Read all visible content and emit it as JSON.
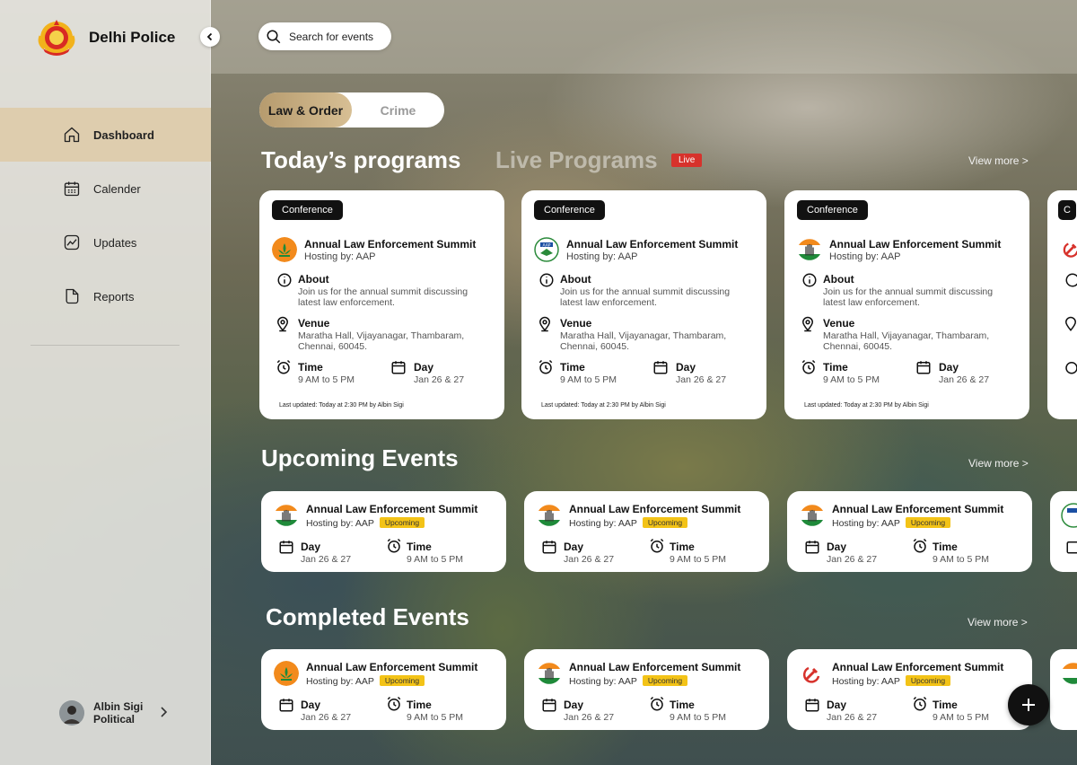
{
  "sidebar": {
    "brand": "Delhi Police",
    "items": [
      {
        "label": "Dashboard",
        "icon": "home-icon",
        "active": true
      },
      {
        "label": "Calender",
        "icon": "calendar-icon",
        "active": false
      },
      {
        "label": "Updates",
        "icon": "trend-chart-icon",
        "active": false
      },
      {
        "label": "Reports",
        "icon": "document-icon",
        "active": false
      }
    ],
    "profile": {
      "name": "Albin Sigi",
      "role": "Political"
    }
  },
  "search": {
    "placeholder": "Search for events"
  },
  "toggle": {
    "options": [
      "Law & Order",
      "Crime"
    ],
    "selected": "Law & Order"
  },
  "sections": {
    "todays": "Today’s programs",
    "live": "Live Programs",
    "live_badge": "Live",
    "upcoming": "Upcoming Events",
    "completed": "Completed Events",
    "view_more": "View more >"
  },
  "program_cards": [
    {
      "tag": "Conference",
      "logo": "bjp-lotus-logo",
      "title": "Annual Law Enforcement Summit",
      "hosting": "Hosting by: AAP",
      "about_label": "About",
      "about": "Join us for the annual summit discussing latest law enforcement.",
      "venue_label": "Venue",
      "venue": "Maratha Hall, Vijayanagar, Thambaram, Chennai, 60045.",
      "time_label": "Time",
      "time": "9 AM to 5 PM",
      "day_label": "Day",
      "day": "Jan 26 & 27",
      "updated": "Last updated: Today at 2:30 PM by Albin Sigi"
    },
    {
      "tag": "Conference",
      "logo": "aap-logo",
      "title": "Annual Law Enforcement Summit",
      "hosting": "Hosting by: AAP",
      "about_label": "About",
      "about": "Join us for the annual summit discussing latest law enforcement.",
      "venue_label": "Venue",
      "venue": "Maratha Hall, Vijayanagar, Thambaram, Chennai, 60045.",
      "time_label": "Time",
      "time": "9 AM to 5 PM",
      "day_label": "Day",
      "day": "Jan 26 & 27",
      "updated": "Last updated: Today at 2:30 PM by Albin Sigi"
    },
    {
      "tag": "Conference",
      "logo": "congress-hand-logo",
      "title": "Annual Law Enforcement Summit",
      "hosting": "Hosting by: AAP",
      "about_label": "About",
      "about": "Join us for the annual summit discussing latest law enforcement.",
      "venue_label": "Venue",
      "venue": "Maratha Hall, Vijayanagar, Thambaram, Chennai, 60045.",
      "time_label": "Time",
      "time": "9 AM to 5 PM",
      "day_label": "Day",
      "day": "Jan 26 & 27",
      "updated": "Last updated: Today at 2:30 PM by Albin Sigi"
    },
    {
      "tag": "C",
      "logo": "hammer-sickle-logo"
    }
  ],
  "upcoming_cards": [
    {
      "logo": "congress-hand-logo",
      "title": "Annual Law Enforcement Summit",
      "hosting": "Hosting by: AAP",
      "status": "Upcoming",
      "day_label": "Day",
      "day": "Jan 26 & 27",
      "time_label": "Time",
      "time": "9 AM to 5 PM"
    },
    {
      "logo": "congress-hand-logo",
      "title": "Annual Law Enforcement Summit",
      "hosting": "Hosting by: AAP",
      "status": "Upcoming",
      "day_label": "Day",
      "day": "Jan 26 & 27",
      "time_label": "Time",
      "time": "9 AM to 5 PM"
    },
    {
      "logo": "congress-hand-logo",
      "title": "Annual Law Enforcement Summit",
      "hosting": "Hosting by: AAP",
      "status": "Upcoming",
      "day_label": "Day",
      "day": "Jan 26 & 27",
      "time_label": "Time",
      "time": "9 AM to 5 PM"
    }
  ],
  "completed_cards": [
    {
      "logo": "bjp-lotus-logo",
      "title": "Annual Law Enforcement Summit",
      "hosting": "Hosting by: AAP",
      "status": "Upcoming",
      "day_label": "Day",
      "day": "Jan 26 & 27",
      "time_label": "Time",
      "time": "9 AM to 5 PM"
    },
    {
      "logo": "congress-hand-logo",
      "title": "Annual Law Enforcement Summit",
      "hosting": "Hosting by: AAP",
      "status": "Upcoming",
      "day_label": "Day",
      "day": "Jan 26 & 27",
      "time_label": "Time",
      "time": "9 AM to 5 PM"
    },
    {
      "logo": "hammer-sickle-logo",
      "title": "Annual Law Enforcement Summit",
      "hosting": "Hosting by: AAP",
      "status": "Upcoming",
      "day_label": "Day",
      "day": "Jan 26 & 27",
      "time_label": "Time",
      "time": "9 AM to 5 PM"
    }
  ],
  "fab": {
    "icon": "plus-icon"
  },
  "colors": {
    "accent_gold": "#c9ad7f",
    "live_red": "#d7322c",
    "upcoming_yellow": "#f3c317",
    "card_bg": "#ffffff"
  }
}
